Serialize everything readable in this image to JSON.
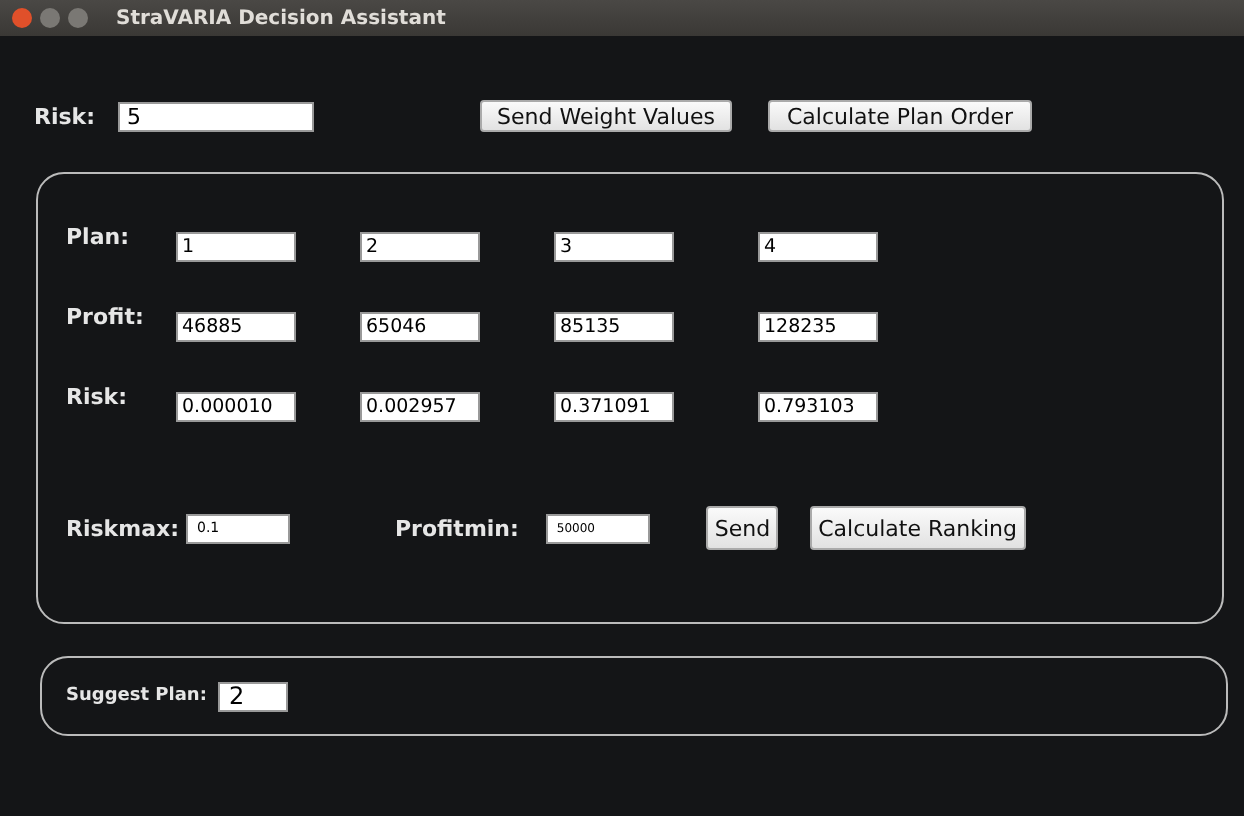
{
  "window": {
    "title": "StraVARIA Decision Assistant"
  },
  "risk": {
    "label": "Risk:",
    "value": "5"
  },
  "top_buttons": [
    "Send Weight Values",
    "Calculate Plan Order"
  ],
  "plan_table": {
    "rows": [
      {
        "label": "Plan:",
        "values": [
          "1",
          "2",
          "3",
          "4"
        ]
      },
      {
        "label": "Profit:",
        "values": [
          "46885",
          "65046",
          "85135",
          "128235"
        ]
      },
      {
        "label": "Risk:",
        "values": [
          "0.000010",
          "0.002957",
          "0.371091",
          "0.793103"
        ]
      }
    ]
  },
  "riskmax": {
    "label": "Riskmax:",
    "value": "0.1"
  },
  "profitmin": {
    "label": "Profitmin:",
    "value": "50000"
  },
  "actions": [
    "Send",
    "Calculate Ranking"
  ],
  "suggest": {
    "label": "Suggest Plan:",
    "value": "2"
  }
}
